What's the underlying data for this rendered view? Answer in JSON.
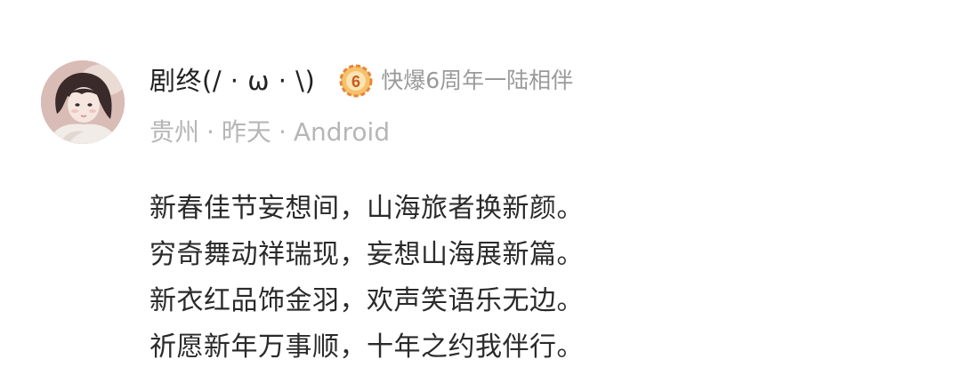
{
  "comment": {
    "user": {
      "name": "剧终(/ · ω · \\)",
      "avatar": "user-avatar-photo"
    },
    "badge": {
      "icon": "anniversary-6-badge-icon",
      "text": "快爆6周年一陆相伴",
      "colors": {
        "ring": "#e6863a",
        "fill": "#f6c16a",
        "number": "#c85a1e"
      }
    },
    "meta": {
      "location": "贵州",
      "time": "昨天",
      "device": "Android",
      "separator": "·"
    },
    "lines": [
      "新春佳节妄想间，山海旅者换新颜。",
      "穷奇舞动祥瑞现，妄想山海展新篇。",
      "新衣红品饰金羽，欢声笑语乐无边。",
      "祈愿新年万事顺，十年之约我伴行。"
    ]
  },
  "colors": {
    "username": "#222222",
    "meta": "#b6b6b6",
    "badge_text": "#9a9a9a",
    "content": "#2a2a2a",
    "background": "#ffffff"
  }
}
